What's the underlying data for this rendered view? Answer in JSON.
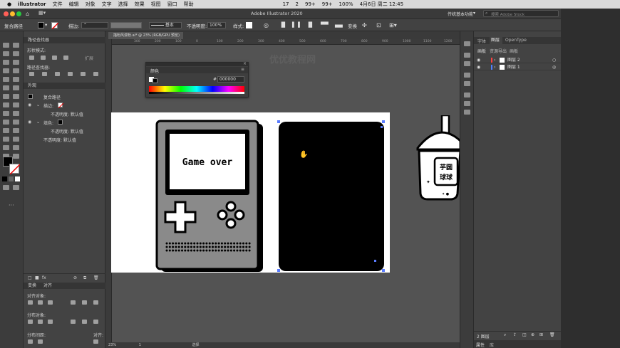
{
  "menubar": {
    "app": "illustrator",
    "items": [
      "文件",
      "编辑",
      "对象",
      "文字",
      "选择",
      "效果",
      "视图",
      "窗口",
      "帮助"
    ],
    "status": [
      "17",
      "2",
      "99+",
      "99+",
      "100%"
    ],
    "clock": "4月6日 周二 12:45"
  },
  "titlebar": {
    "title": "Adobe Illustrator 2020",
    "workspace": "传统基本功能",
    "search_placeholder": "搜索 Adobe Stock"
  },
  "control_bar": {
    "object_type": "复合路径",
    "stroke_label": "描边:",
    "stroke_style": "基本",
    "opacity_label": "不透明度:",
    "opacity_value": "100%",
    "style_label": "样式:",
    "transform_label": "变换"
  },
  "left_panel": {
    "pathfinder_title": "路径查找器",
    "shape_modes_label": "形状模式:",
    "expand_label": "扩展",
    "pathfinders_label": "路径查找器:",
    "appearance_title": "外观",
    "compound_path": "复合路径",
    "stroke": "描边:",
    "opacity_default": "不透明度: 默认值",
    "fill": "填色:",
    "opacity_default2": "不透明度: 默认值",
    "opacity_default3": "不透明度: 默认值",
    "align_tabs": [
      "变换",
      "对齐"
    ],
    "align_objects_label": "对齐对象:",
    "distribute_objects_label": "分布对象:",
    "distribute_spacing_label": "分布间距:",
    "align_to_label": "对齐:"
  },
  "document": {
    "tab_title": "描粉风漫粉.ai* @ 23% (RGB/GPU 预览)",
    "zoom": "23%",
    "page": "1",
    "status_tool": "选择",
    "ruler_ticks": [
      "300",
      "200",
      "100",
      "0",
      "100",
      "200",
      "300",
      "400",
      "500",
      "600",
      "700",
      "800",
      "900",
      "1000",
      "1100",
      "1200"
    ]
  },
  "color_panel": {
    "title": "颜色",
    "hex_label": "#",
    "hex_value": "000000"
  },
  "artwork": {
    "gameboy_text": "Game over",
    "cup_text_line1": "芋圆",
    "cup_text_line2": "球球"
  },
  "watermark": "优优教程网",
  "right_panel": {
    "tabs_top": [
      "字体",
      "图层",
      "OpenType"
    ],
    "tabs_sub": [
      "画板",
      "资源导出",
      "画板"
    ],
    "layers": [
      {
        "name": "图层 2",
        "color": "#ff4040"
      },
      {
        "name": "图层 1",
        "color": "#4f7fff"
      }
    ],
    "layer_count": "2 图层",
    "bottom_tabs": [
      "属性",
      "库"
    ]
  }
}
